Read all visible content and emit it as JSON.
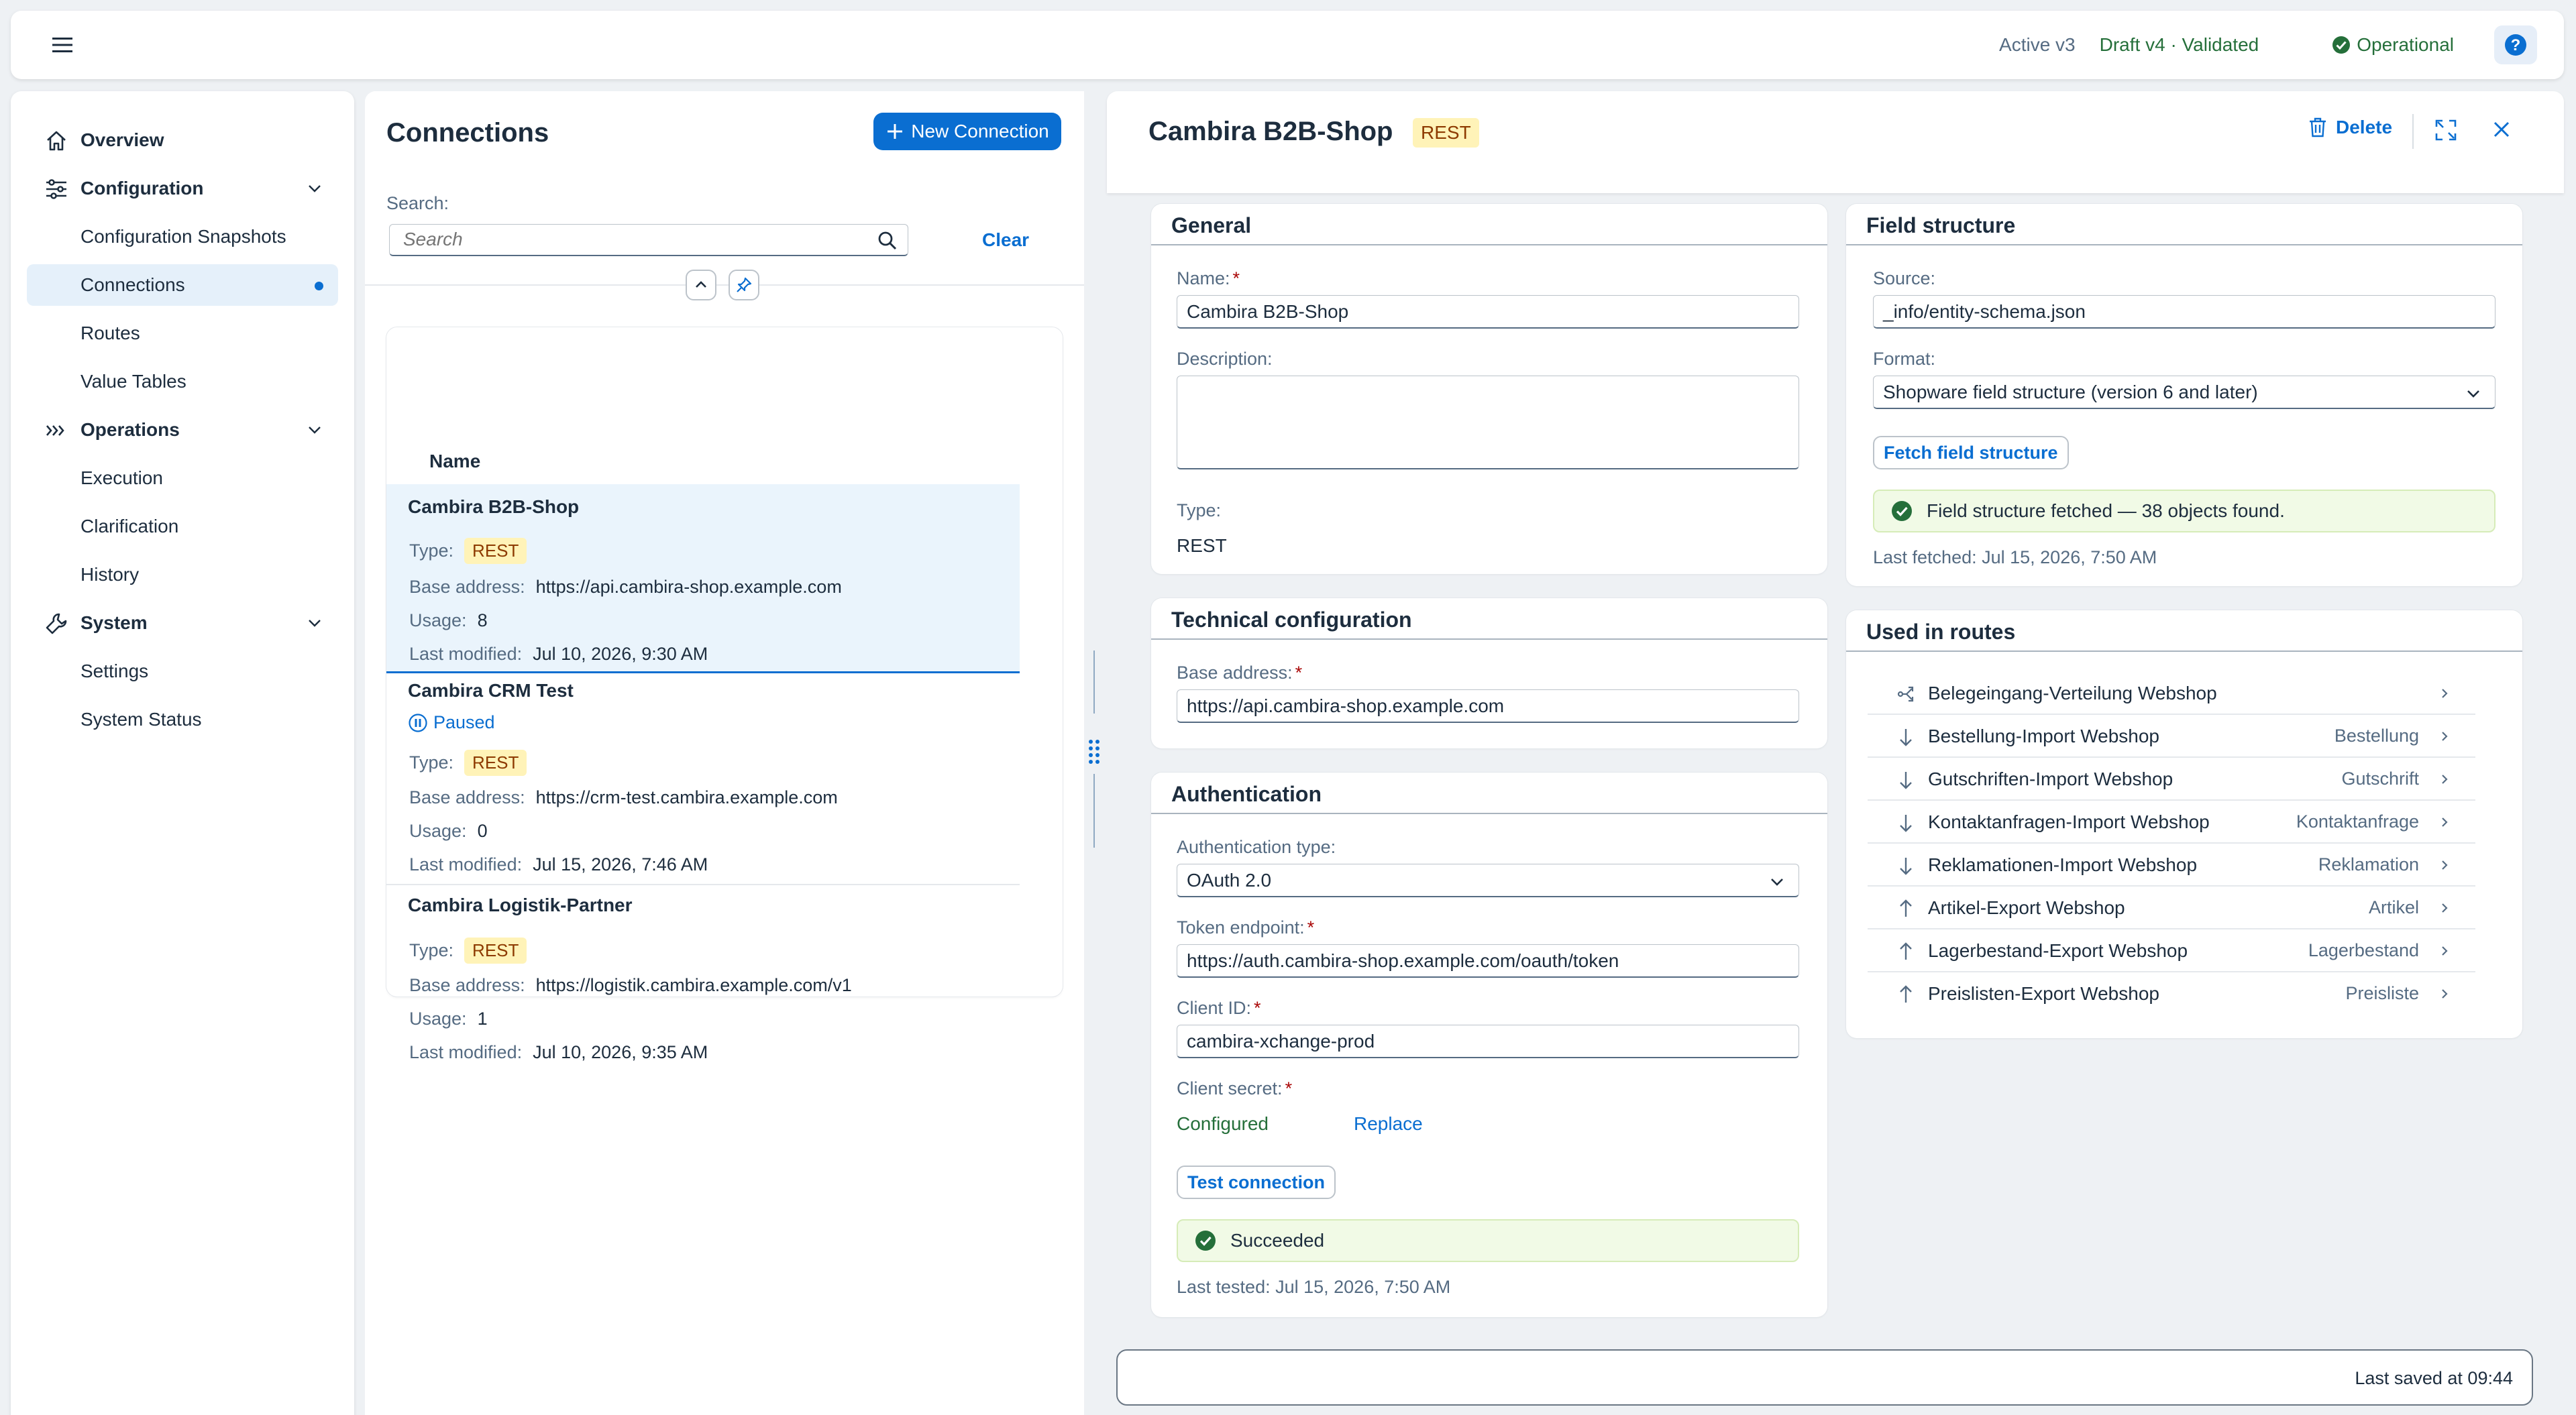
{
  "shell": {
    "active_version": "Active v3",
    "draft_version": "Draft v4 · Validated",
    "status": "Operational",
    "menu_icon": "menu-icon",
    "help_icon": "help-icon"
  },
  "sidebar": {
    "items": [
      {
        "label": "Overview",
        "icon": "home-icon",
        "kind": "group"
      },
      {
        "label": "Configuration",
        "icon": "settings-sliders-icon",
        "kind": "group"
      },
      {
        "label": "Configuration Snapshots",
        "kind": "child"
      },
      {
        "label": "Connections",
        "kind": "child",
        "selected": true
      },
      {
        "label": "Routes",
        "kind": "child"
      },
      {
        "label": "Value Tables",
        "kind": "child"
      },
      {
        "label": "Operations",
        "icon": "operations-icon",
        "kind": "group"
      },
      {
        "label": "Execution",
        "kind": "child"
      },
      {
        "label": "Clarification",
        "kind": "child"
      },
      {
        "label": "History",
        "kind": "child"
      },
      {
        "label": "System",
        "icon": "wrench-icon",
        "kind": "group"
      },
      {
        "label": "Settings",
        "kind": "child"
      },
      {
        "label": "System Status",
        "kind": "child"
      }
    ]
  },
  "connections": {
    "title": "Connections",
    "new_button": "New Connection",
    "search_label": "Search:",
    "search_placeholder": "Search",
    "clear_label": "Clear",
    "column_name": "Name",
    "labels": {
      "type": "Type:",
      "base_address": "Base address:",
      "usage": "Usage:",
      "last_modified": "Last modified:"
    },
    "items": [
      {
        "name": "Cambira B2B-Shop",
        "type": "REST",
        "base_address": "https://api.cambira-shop.example.com",
        "usage": "8",
        "last_modified": "Jul 10, 2026, 9:30 AM",
        "selected": true
      },
      {
        "name": "Cambira CRM Test",
        "status": "Paused",
        "type": "REST",
        "base_address": "https://crm-test.cambira.example.com",
        "usage": "0",
        "last_modified": "Jul 15, 2026, 7:46 AM"
      },
      {
        "name": "Cambira Logistik-Partner",
        "type": "REST",
        "base_address": "https://logistik.cambira.example.com/v1",
        "usage": "1",
        "last_modified": "Jul 10, 2026, 9:35 AM"
      }
    ]
  },
  "detail": {
    "title": "Cambira B2B-Shop",
    "type_badge": "REST",
    "delete_label": "Delete",
    "general": {
      "title": "General",
      "name_label": "Name:",
      "name_value": "Cambira B2B-Shop",
      "description_label": "Description:",
      "description_value": "",
      "type_label": "Type:",
      "type_value": "REST"
    },
    "technical": {
      "title": "Technical configuration",
      "base_address_label": "Base address:",
      "base_address_value": "https://api.cambira-shop.example.com"
    },
    "auth": {
      "title": "Authentication",
      "auth_type_label": "Authentication type:",
      "auth_type_value": "OAuth 2.0",
      "token_label": "Token endpoint:",
      "token_value": "https://auth.cambira-shop.example.com/oauth/token",
      "client_id_label": "Client ID:",
      "client_id_value": "cambira-xchange-prod",
      "client_secret_label": "Client secret:",
      "client_secret_status": "Configured",
      "replace_label": "Replace",
      "test_button": "Test connection",
      "test_result": "Succeeded",
      "last_tested": "Last tested: Jul 15, 2026, 7:50 AM"
    },
    "field_structure": {
      "title": "Field structure",
      "source_label": "Source:",
      "source_value": "_info/entity-schema.json",
      "format_label": "Format:",
      "format_value": "Shopware field structure (version 6 and later)",
      "fetch_button": "Fetch field structure",
      "fetch_result": "Field structure fetched — 38 objects found.",
      "last_fetched": "Last fetched: Jul 15, 2026, 7:50 AM"
    },
    "routes": {
      "title": "Used in routes",
      "items": [
        {
          "name": "Belegeingang-Verteilung Webshop",
          "object": "",
          "direction": "distribute-icon"
        },
        {
          "name": "Bestellung-Import Webshop",
          "object": "Bestellung",
          "direction": "arrow-down-icon"
        },
        {
          "name": "Gutschriften-Import Webshop",
          "object": "Gutschrift",
          "direction": "arrow-down-icon"
        },
        {
          "name": "Kontaktanfragen-Import Webshop",
          "object": "Kontaktanfrage",
          "direction": "arrow-down-icon"
        },
        {
          "name": "Reklamationen-Import Webshop",
          "object": "Reklamation",
          "direction": "arrow-down-icon"
        },
        {
          "name": "Artikel-Export Webshop",
          "object": "Artikel",
          "direction": "arrow-up-icon"
        },
        {
          "name": "Lagerbestand-Export Webshop",
          "object": "Lagerbestand",
          "direction": "arrow-up-icon"
        },
        {
          "name": "Preislisten-Export Webshop",
          "object": "Preisliste",
          "direction": "arrow-up-icon"
        }
      ]
    },
    "footer": {
      "saved": "Last saved at 09:44"
    }
  },
  "colors": {
    "accent": "#0a6ed1",
    "positive": "#256f3a",
    "badge_bg": "#fff3b8",
    "badge_text": "#8d3a00",
    "required": "#aa0808"
  }
}
